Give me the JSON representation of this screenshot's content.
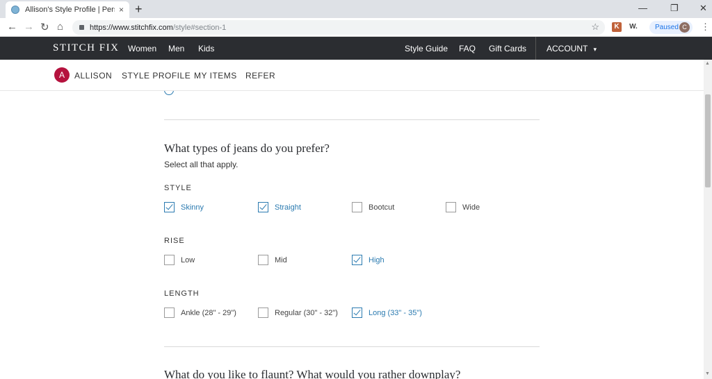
{
  "browser": {
    "tab_title": "Allison's Style Profile | Personal S",
    "tab_close": "×",
    "new_tab": "+",
    "url_host": "https://www.stitchfix.com",
    "url_path": "/style#section-1",
    "ext_ws": "W.",
    "paused_label": "Paused",
    "profile_initial": "C"
  },
  "site": {
    "logo": "STITCH FIX",
    "nav": [
      "Women",
      "Men",
      "Kids"
    ],
    "right_nav": [
      "Style Guide",
      "FAQ",
      "Gift Cards"
    ],
    "account": "ACCOUNT",
    "caret": "▾"
  },
  "subnav": {
    "avatar_letter": "A",
    "user_name": "ALLISON",
    "links": [
      "STYLE PROFILE",
      "MY ITEMS",
      "REFER"
    ]
  },
  "jeans": {
    "question": "What types of jeans do you prefer?",
    "hint": "Select all that apply.",
    "style": {
      "label": "STYLE",
      "options": [
        {
          "label": "Skinny",
          "checked": true
        },
        {
          "label": "Straight",
          "checked": true
        },
        {
          "label": "Bootcut",
          "checked": false
        },
        {
          "label": "Wide",
          "checked": false
        }
      ]
    },
    "rise": {
      "label": "RISE",
      "options": [
        {
          "label": "Low",
          "checked": false
        },
        {
          "label": "Mid",
          "checked": false
        },
        {
          "label": "High",
          "checked": true
        }
      ]
    },
    "length": {
      "label": "LENGTH",
      "options": [
        {
          "label": "Ankle (28\" - 29\")",
          "checked": false
        },
        {
          "label": "Regular (30\" - 32\")",
          "checked": false
        },
        {
          "label": "Long (33\" - 35\")",
          "checked": true
        }
      ]
    }
  },
  "next_question": "What do you like to flaunt? What would you rather downplay?",
  "colors": {
    "accent": "#2a7ab0",
    "nav_bg": "#2b2d31",
    "avatar_bg": "#b5123e"
  }
}
